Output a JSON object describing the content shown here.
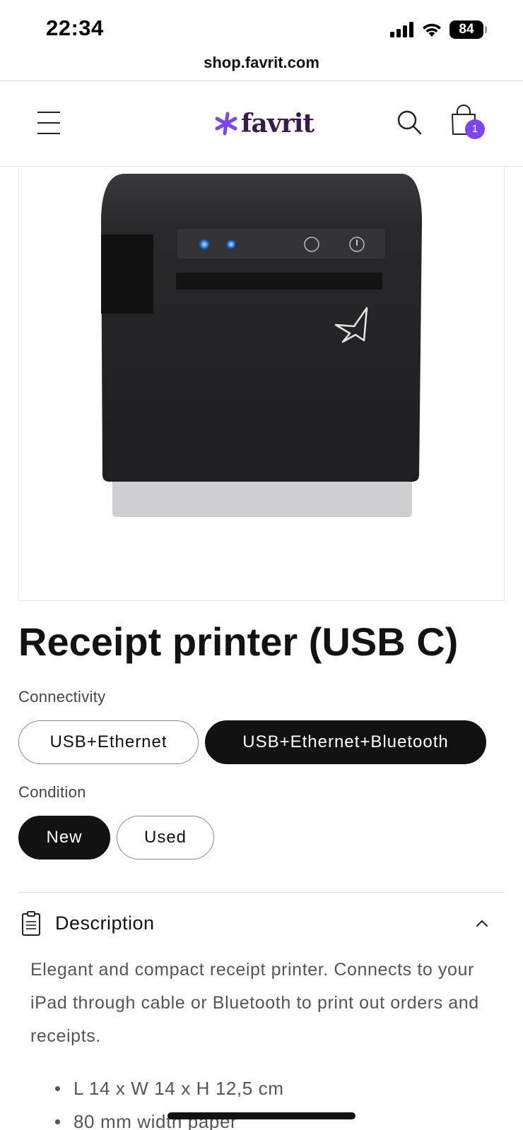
{
  "status_bar": {
    "time": "22:34",
    "battery": "84",
    "icons": [
      "signal-icon",
      "wifi-icon",
      "battery-icon"
    ]
  },
  "browser": {
    "url": "shop.favrit.com"
  },
  "header": {
    "logo_text": "favrit",
    "cart_count": "1",
    "icons": [
      "menu-icon",
      "search-icon",
      "cart-bag-icon"
    ],
    "colors": {
      "logo_asterisk": "#7c45f0",
      "logo_text": "#3a1a4c",
      "badge": "#7c45f0"
    }
  },
  "product": {
    "title": "Receipt printer (USB C)",
    "image_icon": "receipt-printer-image",
    "connectivity": {
      "label": "Connectivity",
      "options": [
        {
          "label": "USB+Ethernet",
          "selected": false
        },
        {
          "label": "USB+Ethernet+Bluetooth",
          "selected": true
        }
      ]
    },
    "condition": {
      "label": "Condition",
      "options": [
        {
          "label": "New",
          "selected": true
        },
        {
          "label": "Used",
          "selected": false
        }
      ]
    }
  },
  "description": {
    "title": "Description",
    "icon": "clipboard-icon",
    "expanded": true,
    "text": "Elegant and compact receipt printer. Connects to your iPad through cable or Bluetooth to print out orders and receipts.",
    "bullets": [
      "L 14 x W 14 x H 12,5 cm",
      "80 mm width paper"
    ]
  }
}
